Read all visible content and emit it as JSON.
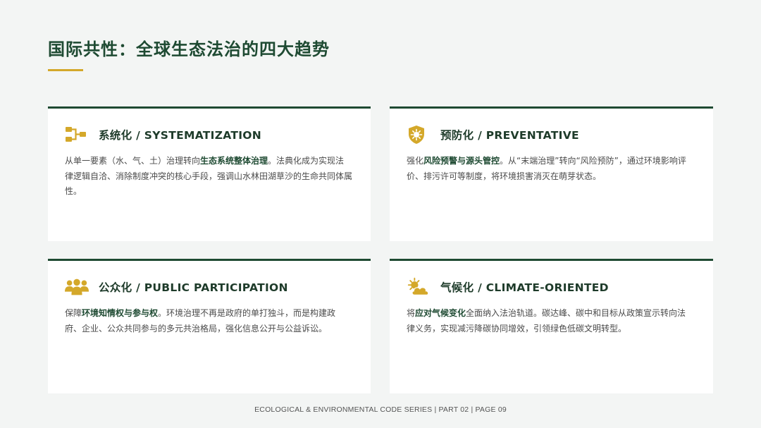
{
  "page": {
    "title": "国际共性：全球生态法治的四大趋势",
    "footer": "ECOLOGICAL & ENVIRONMENTAL CODE SERIES | PART 02 | PAGE 09"
  },
  "colors": {
    "accent_green": "#1e4a32",
    "accent_gold": "#d4a82a"
  },
  "cards": [
    {
      "icon": "hierarchy-icon",
      "heading": "系统化 / SYSTEMATIZATION",
      "pre": "从单一要素（水、气、土）治理转向",
      "bold": "生态系统整体治理",
      "post": "。法典化成为实现法律逻辑自洽、消除制度冲突的核心手段，强调山水林田湖草沙的生命共同体属性。"
    },
    {
      "icon": "shield-virus-icon",
      "heading": "预防化 / PREVENTATIVE",
      "pre": "强化",
      "bold": "风险预警与源头管控",
      "post": "。从“末端治理”转向“风险预防”，通过环境影响评价、排污许可等制度，将环境损害消灭在萌芽状态。"
    },
    {
      "icon": "people-group-icon",
      "heading": "公众化 / PUBLIC PARTICIPATION",
      "pre": "保障",
      "bold": "环境知情权与参与权",
      "post": "。环境治理不再是政府的单打独斗，而是构建政府、企业、公众共同参与的多元共治格局，强化信息公开与公益诉讼。"
    },
    {
      "icon": "sun-cloud-icon",
      "heading": "气候化 / CLIMATE-ORIENTED",
      "pre": "将",
      "bold": "应对气候变化",
      "post": "全面纳入法治轨道。碳达峰、碳中和目标从政策宣示转向法律义务，实现减污降碳协同增效，引领绿色低碳文明转型。"
    }
  ]
}
